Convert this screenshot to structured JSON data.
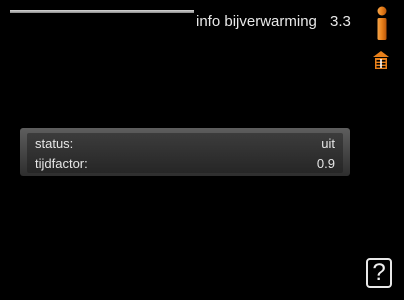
{
  "header": {
    "title": "info bijverwarming",
    "menu_number": "3.3"
  },
  "icons": {
    "info": "info-icon",
    "heater": "heater-icon",
    "help": "help-icon"
  },
  "colors": {
    "background": "#000000",
    "accent_orange": "#e8801a",
    "text": "#e6e6e6"
  },
  "panel": {
    "rows": [
      {
        "label": "status:",
        "value": "uit"
      },
      {
        "label": "tijdfactor:",
        "value": "0.9"
      }
    ]
  },
  "help_button": {
    "label": "?"
  }
}
